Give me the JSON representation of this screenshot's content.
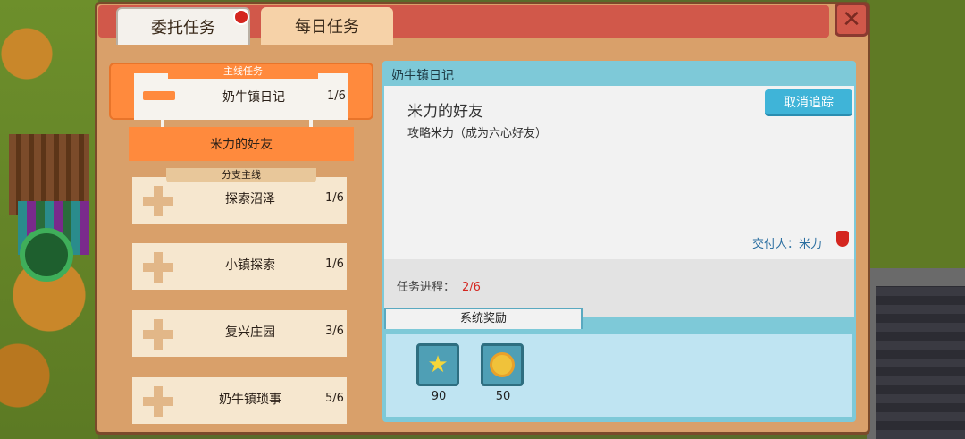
{
  "tabs": [
    {
      "label": "委托任务",
      "active": true,
      "has_notification": true
    },
    {
      "label": "每日任务",
      "active": false
    }
  ],
  "close_icon": "close-icon",
  "quest_list": {
    "main": {
      "header": "主线任务",
      "name": "奶牛镇日记",
      "count": "1/6"
    },
    "selected_sub": "米力的好友",
    "branch": [
      {
        "header": "分支主线",
        "name": "探索沼泽",
        "count": "1/6"
      },
      {
        "name": "小镇探索",
        "count": "1/6"
      },
      {
        "name": "复兴庄园",
        "count": "3/6"
      },
      {
        "name": "奶牛镇琐事",
        "count": "5/6"
      }
    ]
  },
  "detail": {
    "title": "奶牛镇日记",
    "quest_name": "米力的好友",
    "description": "攻略米力（成为六心好友）",
    "track_button": "取消追踪",
    "giver": "交付人：米力",
    "progress_label": "任务进程：",
    "progress_value": "2/6",
    "rewards_tab": "系统奖励",
    "rewards": [
      {
        "icon": "star-icon",
        "amount": "90"
      },
      {
        "icon": "coin-icon",
        "amount": "50"
      }
    ]
  },
  "colors": {
    "accent": "#ff8a3d",
    "panel": "#7ec9d8",
    "header": "#d1584a"
  }
}
